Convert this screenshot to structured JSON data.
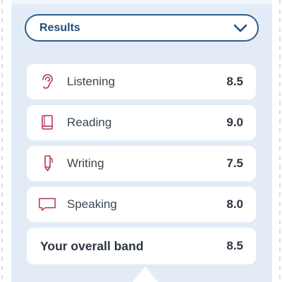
{
  "results_dropdown": {
    "label": "Results",
    "icon": "chevron-down-icon"
  },
  "skills": [
    {
      "label": "Listening",
      "score": "8.5",
      "icon": "ear-icon"
    },
    {
      "label": "Reading",
      "score": "9.0",
      "icon": "book-icon"
    },
    {
      "label": "Writing",
      "score": "7.5",
      "icon": "pen-icon"
    },
    {
      "label": "Speaking",
      "score": "8.0",
      "icon": "speech-bubble-icon"
    }
  ],
  "overall": {
    "label": "Your overall band",
    "score": "8.5"
  },
  "colors": {
    "accent": "#b8325a",
    "brand": "#1f4f7a",
    "panel": "#e3ecf6"
  }
}
